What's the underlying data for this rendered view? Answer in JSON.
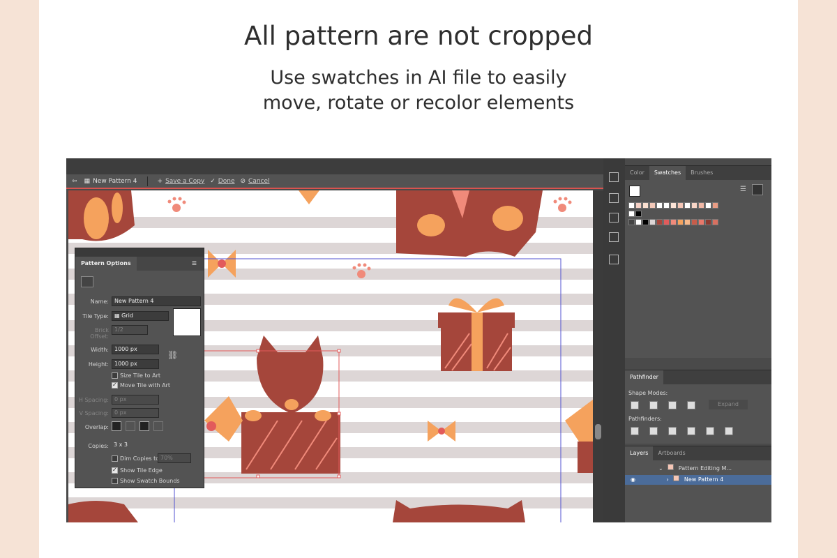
{
  "headline": "All pattern are not cropped",
  "subtitle_line1": "Use swatches in AI file to easily",
  "subtitle_line2": "move, rotate or recolor elements",
  "editbar": {
    "pattern_name": "New Pattern 4",
    "save_copy": "Save a Copy",
    "done": "Done",
    "cancel": "Cancel"
  },
  "pattern_options": {
    "title": "Pattern Options",
    "name_label": "Name:",
    "name_value": "New Pattern 4",
    "tile_type_label": "Tile Type:",
    "tile_type_value": "Grid",
    "brick_offset_label": "Brick Offset:",
    "brick_offset_value": "1/2",
    "width_label": "Width:",
    "width_value": "1000 px",
    "height_label": "Height:",
    "height_value": "1000 px",
    "size_tile_label": "Size Tile to Art",
    "move_tile_label": "Move Tile with Art",
    "h_spacing_label": "H Spacing:",
    "h_spacing_value": "0 px",
    "v_spacing_label": "V Spacing:",
    "v_spacing_value": "0 px",
    "overlap_label": "Overlap:",
    "copies_label": "Copies:",
    "copies_value": "3 x 3",
    "dim_copies_label": "Dim Copies to:",
    "dim_copies_value": "70%",
    "show_tile_edge_label": "Show Tile Edge",
    "show_swatch_bounds_label": "Show Swatch Bounds"
  },
  "swatches_panel": {
    "tabs": [
      "Color",
      "Swatches",
      "Brushes"
    ],
    "active_tab": "Swatches"
  },
  "pathfinder_panel": {
    "title": "Pathfinder",
    "shape_modes_label": "Shape Modes:",
    "expand_label": "Expand",
    "pathfinders_label": "Pathfinders:"
  },
  "layers_panel": {
    "tabs": [
      "Layers",
      "Artboards"
    ],
    "active_tab": "Layers",
    "rows": [
      "Pattern Editing M...",
      "New Pattern 4"
    ]
  },
  "colors": {
    "brick": "#a5463b",
    "orange": "#f5a25d",
    "peach_stripe": "#ddd6d6",
    "pink_paw": "#f08a7a",
    "selection": "#e25b5b",
    "tile_edge": "#5050d0"
  }
}
